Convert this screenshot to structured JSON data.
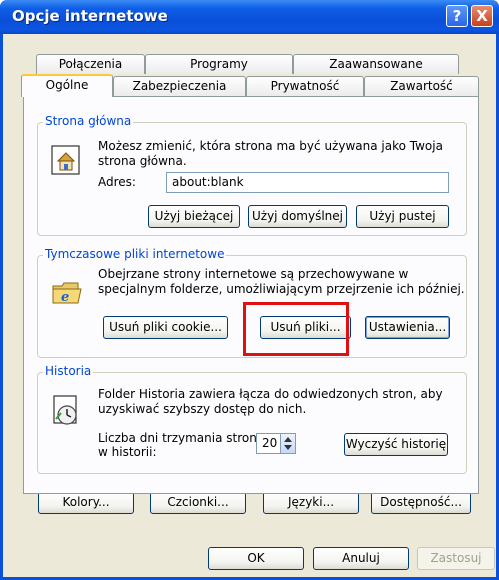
{
  "window": {
    "title": "Opcje internetowe",
    "help_label": "?",
    "close_label": "X"
  },
  "tabs_back": [
    "Połączenia",
    "Programy",
    "Zaawansowane"
  ],
  "tabs_front": [
    "Ogólne",
    "Zabezpieczenia",
    "Prywatność",
    "Zawartość"
  ],
  "homepage": {
    "group_label": "Strona główna",
    "description_line1": "Możesz zmienić, która strona ma być używana jako Twoja",
    "description_line2": "strona główna.",
    "address_label": "Adres:",
    "address_value": "about:blank",
    "btn_current": "Użyj bieżącej",
    "btn_default": "Użyj domyślnej",
    "btn_blank": "Użyj pustej"
  },
  "temp_files": {
    "group_label": "Tymczasowe pliki internetowe",
    "description_line1": "Obejrzane strony internetowe są przechowywane w",
    "description_line2": "specjalnym folderze, umożliwiającym przejrzenie ich później.",
    "btn_delete_cookies": "Usuń pliki cookie...",
    "btn_delete_files": "Usuń pliki...",
    "btn_settings": "Ustawienia..."
  },
  "history": {
    "group_label": "Historia",
    "description_line1": "Folder Historia zawiera łącza do odwiedzonych stron, aby",
    "description_line2": "uzyskiwać szybszy dostęp do nich.",
    "days_label_line1": "Liczba dni trzymania stron",
    "days_label_line2": "w historii:",
    "days_value": "20",
    "btn_clear": "Wyczyść historię"
  },
  "bottom_buttons": {
    "colors": "Kolory...",
    "fonts": "Czcionki...",
    "languages": "Języki...",
    "accessibility": "Dostępność..."
  },
  "dialog_buttons": {
    "ok": "OK",
    "cancel": "Anuluj",
    "apply": "Zastosuj"
  },
  "colors": {
    "titlebar": "#0a4fd8",
    "group_label": "#0046d5",
    "highlight": "#e01010"
  }
}
